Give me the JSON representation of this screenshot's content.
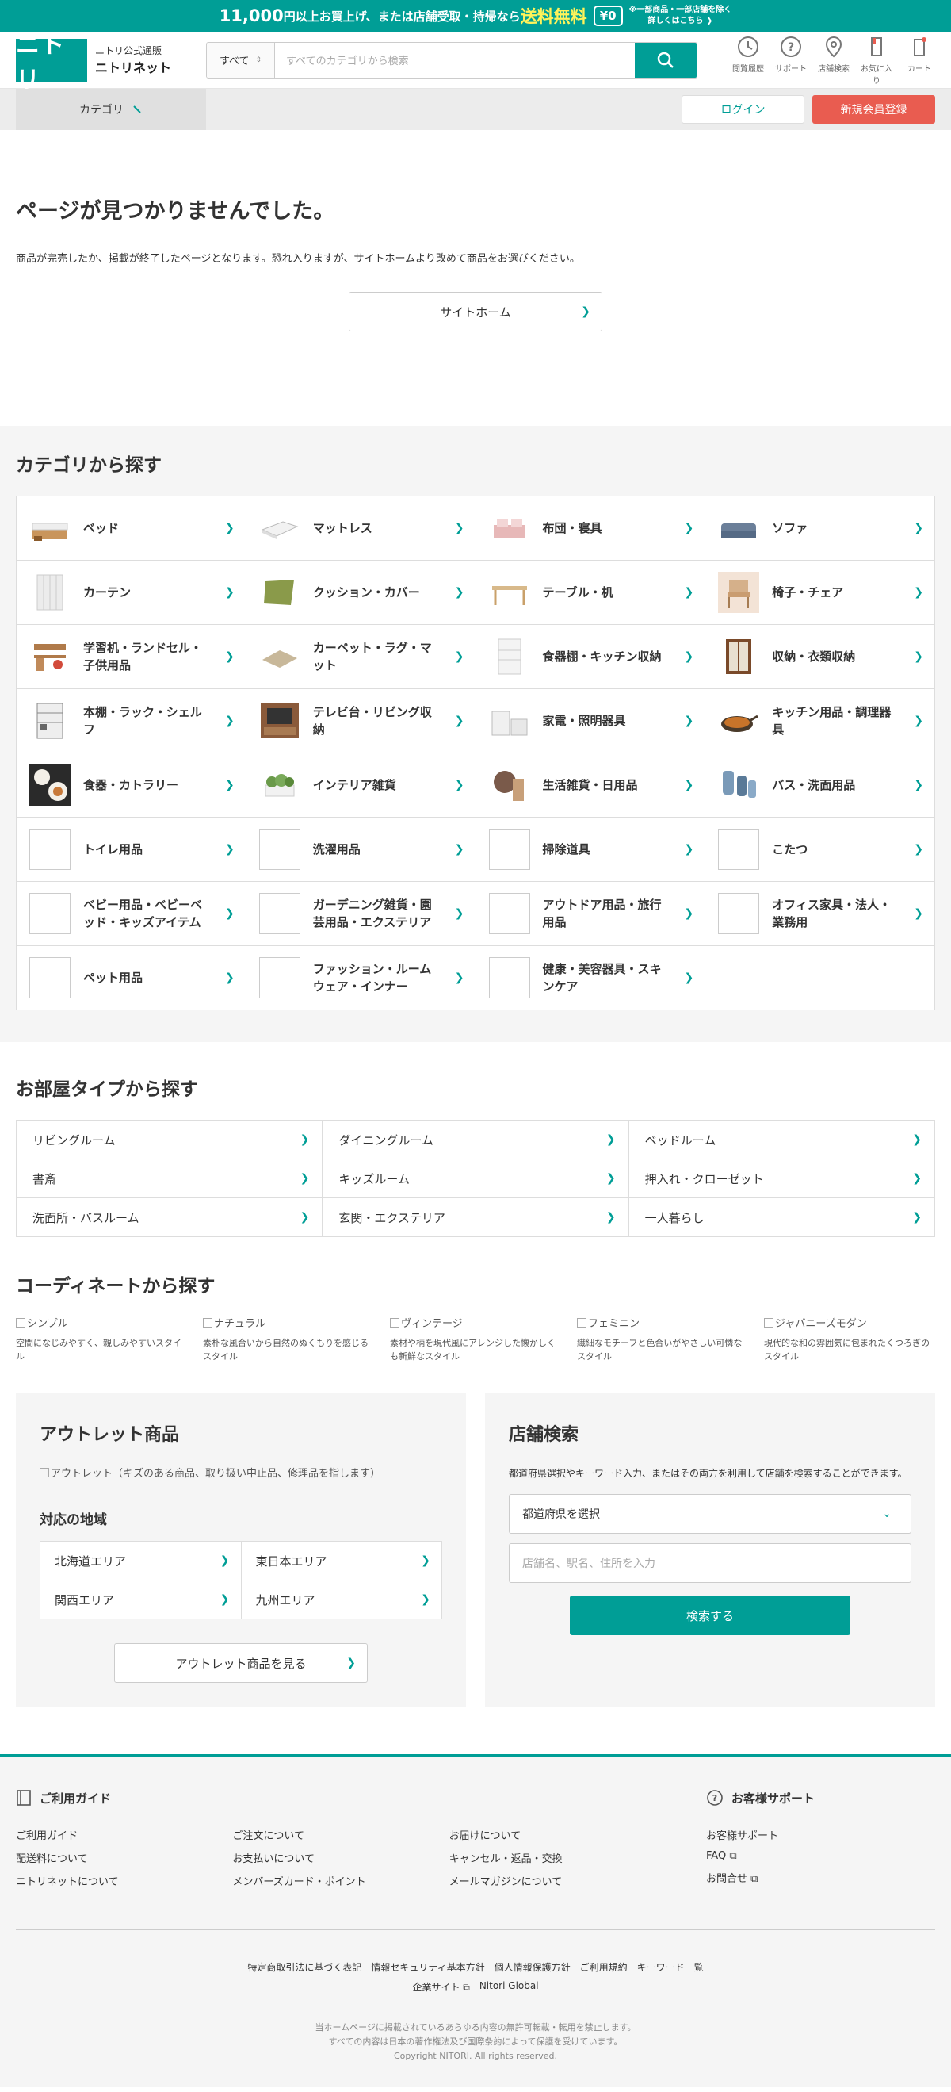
{
  "promo": {
    "amount": "11,000",
    "text1": "円以上お買上げ、または店舗受取・持帰なら",
    "free": "送料無料",
    "zero": "¥0",
    "note1": "※一部商品・一部店舗を除く",
    "note2": "詳しくはこちら ❯"
  },
  "header": {
    "logo_mark": "ニトリ",
    "logo_small": "ニトリ公式通販",
    "logo_name": "ニトリネット",
    "search_category": "すべて",
    "search_placeholder": "すべてのカテゴリから検索",
    "icons": [
      {
        "label": "閲覧履歴"
      },
      {
        "label": "サポート"
      },
      {
        "label": "店舗検索"
      },
      {
        "label": "お気に入り"
      },
      {
        "label": "カート"
      }
    ]
  },
  "subnav": {
    "category": "カテゴリ",
    "login": "ログイン",
    "register": "新規会員登録"
  },
  "notfound": {
    "title": "ページが見つかりませんでした。",
    "message": "商品が完売したか、掲載が終了したページとなります。恐れ入りますが、サイトホームより改めて商品をお選びください。",
    "home_button": "サイトホーム"
  },
  "categories": {
    "title": "カテゴリから探す",
    "items": [
      {
        "label": "ベッド"
      },
      {
        "label": "マットレス"
      },
      {
        "label": "布団・寝具"
      },
      {
        "label": "ソファ"
      },
      {
        "label": "カーテン"
      },
      {
        "label": "クッション・カバー"
      },
      {
        "label": "テーブル・机"
      },
      {
        "label": "椅子・チェア"
      },
      {
        "label": "学習机・ランドセル・子供用品"
      },
      {
        "label": "カーペット・ラグ・マット"
      },
      {
        "label": "食器棚・キッチン収納"
      },
      {
        "label": "収納・衣類収納"
      },
      {
        "label": "本棚・ラック・シェルフ"
      },
      {
        "label": "テレビ台・リビング収納"
      },
      {
        "label": "家電・照明器具"
      },
      {
        "label": "キッチン用品・調理器具"
      },
      {
        "label": "食器・カトラリー"
      },
      {
        "label": "インテリア雑貨"
      },
      {
        "label": "生活雑貨・日用品"
      },
      {
        "label": "バス・洗面用品"
      },
      {
        "label": "トイレ用品"
      },
      {
        "label": "洗濯用品"
      },
      {
        "label": "掃除道具"
      },
      {
        "label": "こたつ"
      },
      {
        "label": "ベビー用品・ベビーベッド・キッズアイテム"
      },
      {
        "label": "ガーデニング雑貨・園芸用品・エクステリア"
      },
      {
        "label": "アウトドア用品・旅行用品"
      },
      {
        "label": "オフィス家具・法人・業務用"
      },
      {
        "label": "ペット用品"
      },
      {
        "label": "ファッション・ルームウェア・インナー"
      },
      {
        "label": "健康・美容器具・スキンケア"
      }
    ]
  },
  "rooms": {
    "title": "お部屋タイプから探す",
    "items": [
      {
        "label": "リビングルーム"
      },
      {
        "label": "ダイニングルーム"
      },
      {
        "label": "ベッドルーム"
      },
      {
        "label": "書斎"
      },
      {
        "label": "キッズルーム"
      },
      {
        "label": "押入れ・クローゼット"
      },
      {
        "label": "洗面所・バスルーム"
      },
      {
        "label": "玄関・エクステリア"
      },
      {
        "label": "一人暮らし"
      }
    ]
  },
  "coordinate": {
    "title": "コーディネートから探す",
    "items": [
      {
        "name": "シンプル",
        "desc": "空間になじみやすく、親しみやすいスタイル"
      },
      {
        "name": "ナチュラル",
        "desc": "素朴な風合いから自然のぬくもりを感じるスタイル"
      },
      {
        "name": "ヴィンテージ",
        "desc": "素材や柄を現代風にアレンジした懐かしくも新鮮なスタイル"
      },
      {
        "name": "フェミニン",
        "desc": "繊細なモチーフと色合いがやさしい可憐なスタイル"
      },
      {
        "name": "ジャパニーズモダン",
        "desc": "現代的な和の雰囲気に包まれたくつろぎのスタイル"
      }
    ]
  },
  "outlet": {
    "title": "アウトレット商品",
    "image_alt": "アウトレット（キズのある商品、取り扱い中止品、修理品を指します）",
    "region_title": "対応の地域",
    "regions": [
      {
        "label": "北海道エリア"
      },
      {
        "label": "東日本エリア"
      },
      {
        "label": "関西エリア"
      },
      {
        "label": "九州エリア"
      }
    ],
    "button": "アウトレット商品を見る"
  },
  "store": {
    "title": "店舗検索",
    "desc": "都道府県選択やキーワード入力、またはその両方を利用して店舗を検索することができます。",
    "select": "都道府県を選択",
    "placeholder": "店舗名、駅名、住所を入力",
    "button": "検索する"
  },
  "footer": {
    "guide_title": "ご利用ガイド",
    "guide_links": [
      "ご利用ガイド",
      "ご注文について",
      "お届けについて",
      "配送料について",
      "お支払いについて",
      "キャンセル・返品・交換",
      "ニトリネットについて",
      "メンバーズカード・ポイント",
      "メールマガジンについて"
    ],
    "support_title": "お客様サポート",
    "support_links": [
      "お客様サポート",
      "FAQ ⧉",
      "お問合せ ⧉"
    ],
    "bottom_links1": [
      "特定商取引法に基づく表記",
      "情報セキュリティ基本方針",
      "個人情報保護方針",
      "ご利用規約",
      "キーワード一覧"
    ],
    "bottom_links2": [
      "企業サイト ⧉",
      "Nitori Global"
    ],
    "copy1": "当ホームページに掲載されているあらゆる内容の無許可転載・転用を禁止します。",
    "copy2": "すべての内容は日本の著作権法及び国際条約によって保護を受けています。",
    "copy3": "Copyright NITORI. All rights reserved."
  },
  "colors": {
    "brand": "#009e96",
    "register": "#e95c50"
  }
}
